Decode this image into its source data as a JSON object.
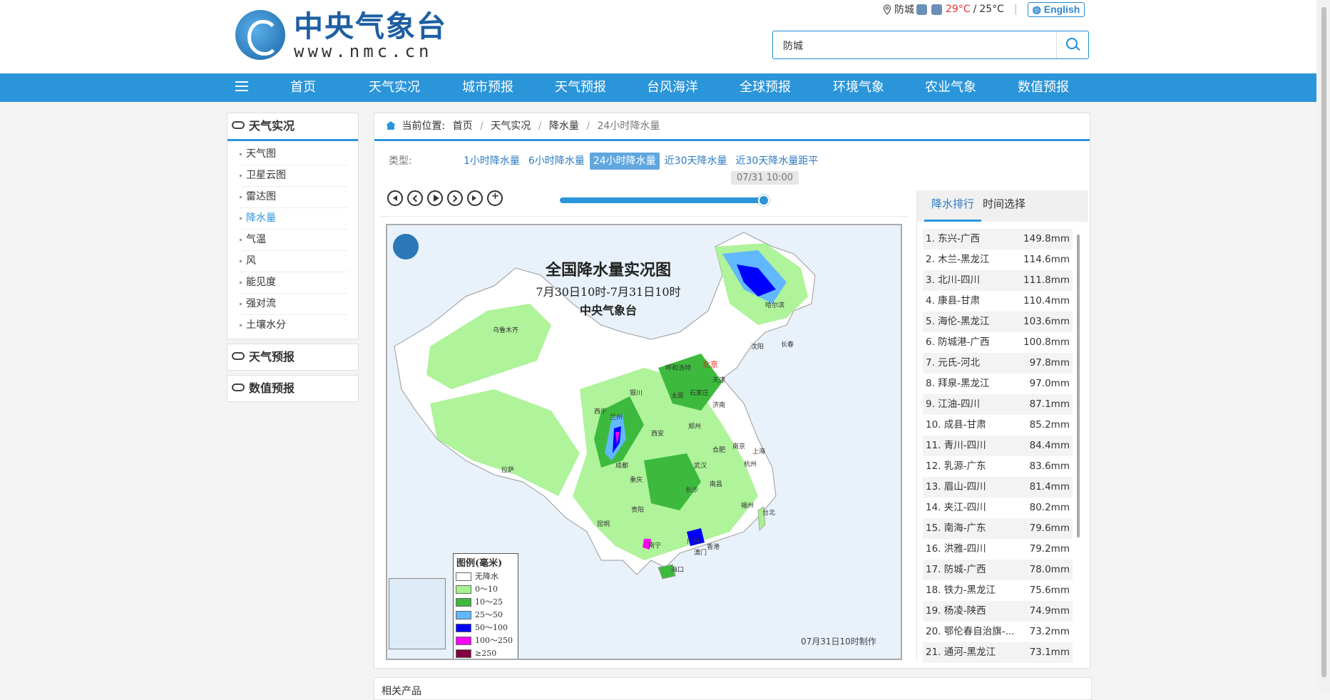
{
  "header": {
    "logo_title": "中央气象台",
    "logo_url": "www.nmc.cn",
    "city": "防城",
    "temp_high": "29°C",
    "temp_sep": "/",
    "temp_low": "25°C",
    "lang_button": "English",
    "search_value": "防城"
  },
  "nav": {
    "items": [
      "首页",
      "天气实况",
      "城市预报",
      "天气预报",
      "台风海洋",
      "全球预报",
      "环境气象",
      "农业气象",
      "数值预报"
    ]
  },
  "sidebar": {
    "section1": "天气实况",
    "items": [
      "天气图",
      "卫星云图",
      "雷达图",
      "降水量",
      "气温",
      "风",
      "能见度",
      "强对流",
      "土壤水分"
    ],
    "section2": "天气预报",
    "section3": "数值预报"
  },
  "breadcrumb": {
    "label": "当前位置:",
    "items": [
      "首页",
      "天气实况",
      "降水量",
      "24小时降水量"
    ]
  },
  "types": {
    "label": "类型:",
    "options": [
      "1小时降水量",
      "6小时降水量",
      "24小时降水量",
      "近30天降水量",
      "近30天降水量距平"
    ],
    "selected": "24小时降水量"
  },
  "time_tip": "07/31 10:00",
  "slider_progress": 1.0,
  "map": {
    "title": "全国降水量实况图",
    "period": "7月30日10时-7月31日10时",
    "source": "中央气象台",
    "date_stamp": "07月31日10时制作",
    "cities": [
      "乌鲁木齐",
      "哈尔滨",
      "长春",
      "呼和浩特",
      "北京",
      "天津",
      "沈阳",
      "银川",
      "太原",
      "石家庄",
      "济南",
      "西宁",
      "兰州",
      "西安",
      "郑州",
      "合肥",
      "南京",
      "上海",
      "拉萨",
      "成都",
      "重庆",
      "武汉",
      "杭州",
      "长沙",
      "南昌",
      "福州",
      "台北",
      "贵阳",
      "昆明",
      "南宁",
      "广州",
      "香港",
      "澳门",
      "海口"
    ],
    "capital": "北京",
    "legend": {
      "title": "图例(毫米)",
      "rows": [
        {
          "label": "无降水",
          "color": "#ffffff"
        },
        {
          "label": "0～10",
          "color": "#a6f28f"
        },
        {
          "label": "10～25",
          "color": "#3dba3d"
        },
        {
          "label": "25～50",
          "color": "#61b8ff"
        },
        {
          "label": "50～100",
          "color": "#0000ff"
        },
        {
          "label": "100～250",
          "color": "#fa00fa"
        },
        {
          "label": "≥250",
          "color": "#800040"
        }
      ]
    }
  },
  "ranking": {
    "tabs": [
      "降水排行",
      "时间选择"
    ],
    "rows": [
      {
        "name": "1. 东兴-广西",
        "value": "149.8mm"
      },
      {
        "name": "2. 木兰-黑龙江",
        "value": "114.6mm"
      },
      {
        "name": "3. 北川-四川",
        "value": "111.8mm"
      },
      {
        "name": "4. 康县-甘肃",
        "value": "110.4mm"
      },
      {
        "name": "5. 海伦-黑龙江",
        "value": "103.6mm"
      },
      {
        "name": "6. 防城港-广西",
        "value": "100.8mm"
      },
      {
        "name": "7. 元氏-河北",
        "value": "97.8mm"
      },
      {
        "name": "8. 拜泉-黑龙江",
        "value": "97.0mm"
      },
      {
        "name": "9. 江油-四川",
        "value": "87.1mm"
      },
      {
        "name": "10. 成县-甘肃",
        "value": "85.2mm"
      },
      {
        "name": "11. 青川-四川",
        "value": "84.4mm"
      },
      {
        "name": "12. 乳源-广东",
        "value": "83.6mm"
      },
      {
        "name": "13. 眉山-四川",
        "value": "81.4mm"
      },
      {
        "name": "14. 夹江-四川",
        "value": "80.2mm"
      },
      {
        "name": "15. 南海-广东",
        "value": "79.6mm"
      },
      {
        "name": "16. 洪雅-四川",
        "value": "79.2mm"
      },
      {
        "name": "17. 防城-广西",
        "value": "78.0mm"
      },
      {
        "name": "18. 铁力-黑龙江",
        "value": "75.6mm"
      },
      {
        "name": "19. 杨凌-陕西",
        "value": "74.9mm"
      },
      {
        "name": "20. 鄂伦春自治旗-...",
        "value": "73.2mm"
      },
      {
        "name": "21. 通河-黑龙江",
        "value": "73.1mm"
      }
    ]
  },
  "bottom_title": "相关产品"
}
